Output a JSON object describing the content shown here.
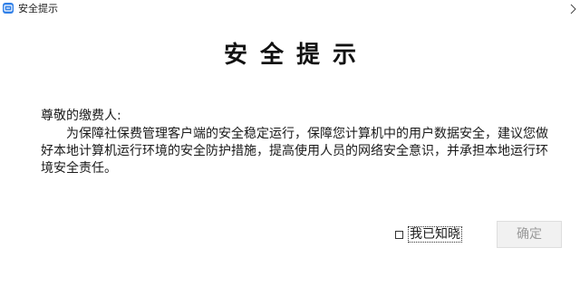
{
  "window": {
    "title": "安全提示",
    "icon": "app-icon",
    "accent": "#2f7fe8"
  },
  "dialog": {
    "heading": "安全提示",
    "salutation": "尊敬的缴费人:",
    "message": "为保障社保费管理客户端的安全稳定运行，保障您计算机中的用户数据安全，建议您做好本地计算机运行环境的安全防护措施，提高使用人员的网络安全意识，并承担本地运行环境安全责任。",
    "acknowledge": {
      "label": "我已知晓",
      "checked": false
    },
    "confirm_button": {
      "label": "确定",
      "enabled": false
    }
  }
}
